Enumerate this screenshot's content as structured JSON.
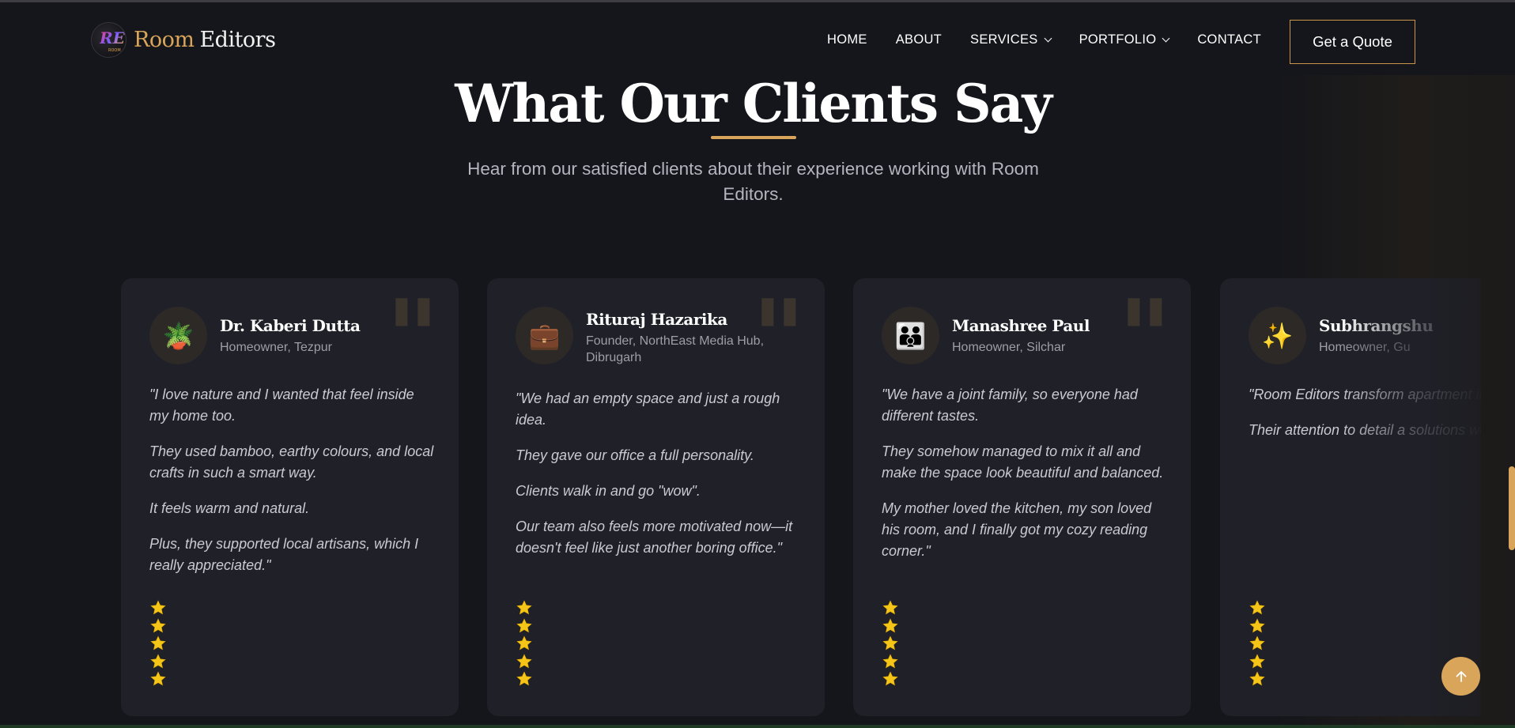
{
  "brand": {
    "word1": "Room",
    "word2": "Editors",
    "badge_small": "ROOM"
  },
  "nav": {
    "items": [
      {
        "label": "HOME",
        "has_dropdown": false
      },
      {
        "label": "ABOUT",
        "has_dropdown": false
      },
      {
        "label": "SERVICES",
        "has_dropdown": true
      },
      {
        "label": "PORTFOLIO",
        "has_dropdown": true
      },
      {
        "label": "CONTACT",
        "has_dropdown": false
      }
    ],
    "cta": "Get a Quote"
  },
  "section": {
    "title": "What Our Clients Say",
    "subtitle": "Hear from our satisfied clients about their experience working with Room Editors."
  },
  "testimonials": [
    {
      "avatar_icon": "potted-plant-icon",
      "avatar_glyph": "🪴",
      "name": "Dr. Kaberi Dutta",
      "role": "Homeowner, Tezpur",
      "paragraphs": [
        "\"I love nature and I wanted that feel inside my home too.",
        "They used bamboo, earthy colours, and local crafts in such a smart way.",
        "It feels warm and natural.",
        "Plus, they supported local artisans, which I really appreciated.\""
      ],
      "rating": 5
    },
    {
      "avatar_icon": "briefcase-icon",
      "avatar_glyph": "💼",
      "name": "Rituraj Hazarika",
      "role": "Founder, NorthEast Media Hub, Dibrugarh",
      "paragraphs": [
        "\"We had an empty space and just a rough idea.",
        "They gave our office a full personality.",
        "Clients walk in and go \"wow\".",
        "Our team also feels more motivated now—it doesn't feel like just another boring office.\""
      ],
      "rating": 5
    },
    {
      "avatar_icon": "family-icon",
      "avatar_glyph": "👪",
      "name": "Manashree Paul",
      "role": "Homeowner, Silchar",
      "paragraphs": [
        "\"We have a joint family, so everyone had different tastes.",
        "They somehow managed to mix it all and make the space look beautiful and balanced.",
        "My mother loved the kitchen, my son loved his room, and I finally got my cozy reading corner.\""
      ],
      "rating": 5
    },
    {
      "avatar_icon": "sparkles-icon",
      "avatar_glyph": "✨",
      "name": "Subhrangshu",
      "role": "Homeowner, Gu",
      "paragraphs": [
        "\"Room Editors transform apartment into a dream h",
        "Their attention to detail a solutions were beyond o"
      ],
      "rating": 5
    }
  ],
  "colors": {
    "accent": "#d9a55b",
    "background": "#15161b",
    "card": "#1f2028",
    "star": "#f5c518"
  }
}
